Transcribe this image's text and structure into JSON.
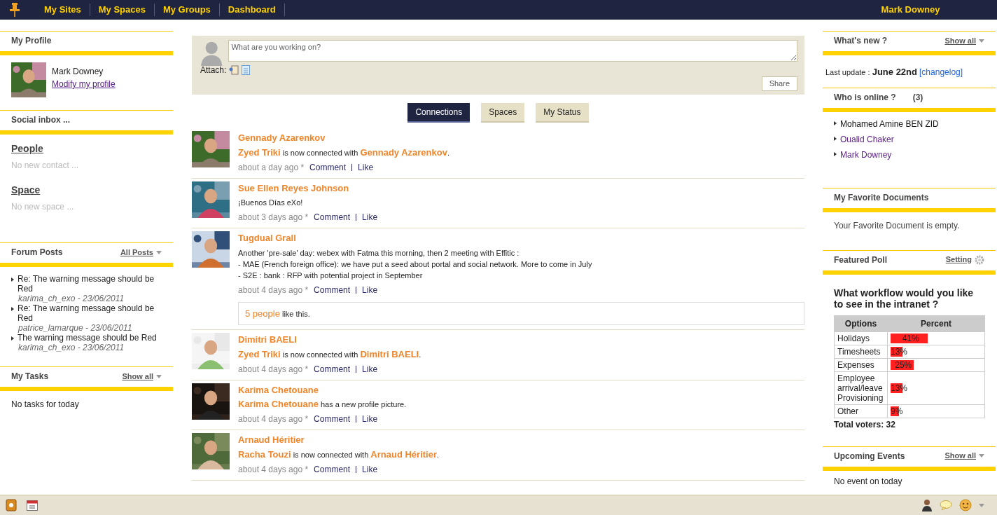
{
  "topbar": {
    "nav": [
      {
        "label": "My Sites"
      },
      {
        "label": "My Spaces"
      },
      {
        "label": "My Groups"
      },
      {
        "label": "Dashboard"
      }
    ],
    "user": "Mark Downey"
  },
  "left": {
    "profile": {
      "title": "My Profile",
      "name": "Mark Downey",
      "link": "Modify my profile"
    },
    "social_inbox": {
      "title": "Social inbox ...",
      "sections": [
        {
          "heading": "People",
          "empty": "No new contact ..."
        },
        {
          "heading": "Space",
          "empty": "No new space ..."
        }
      ]
    },
    "forum": {
      "title": "Forum Posts",
      "action": "All Posts",
      "posts": [
        {
          "title": "Re: The warning message should be Red",
          "meta": "karima_ch_exo - 23/06/2011"
        },
        {
          "title": "Re: The warning message should be Red",
          "meta": "patrice_lamarque - 23/06/2011"
        },
        {
          "title": "The warning message should be Red",
          "meta": "karima_ch_exo - 23/06/2011"
        }
      ]
    },
    "tasks": {
      "title": "My Tasks",
      "action": "Show all",
      "empty": "No tasks for today"
    }
  },
  "composer": {
    "placeholder": "What are you working on?",
    "attach_label": "Attach:",
    "button": "Share"
  },
  "tabs": [
    {
      "label": "Connections",
      "selected": true
    },
    {
      "label": "Spaces",
      "selected": false
    },
    {
      "label": "My Status",
      "selected": false
    }
  ],
  "activities": [
    {
      "name": "Gennady Azarenkov",
      "message": [
        {
          "text": "Zyed Triki",
          "kind": "name"
        },
        {
          "text": " is now connected with ",
          "kind": "text"
        },
        {
          "text": "Gennady Azarenkov",
          "kind": "name"
        },
        {
          "text": ".",
          "kind": "text"
        }
      ],
      "time": "about a day ago *",
      "comment": "Comment",
      "like": "Like"
    },
    {
      "name": "Sue Ellen Reyes Johnson",
      "message": [
        {
          "text": "¡Buenos Días eXo!",
          "kind": "text"
        }
      ],
      "time": "about 3 days ago *",
      "comment": "Comment",
      "like": "Like"
    },
    {
      "name": "Tugdual Grall",
      "message": [
        {
          "text": "Another 'pre-sale' day: webex with Fatma this morning, then 2 meeting with Effitic :\n- MAE (French foreign office): we have put a seed about portal and social network. More to come in July\n- S2E : bank : RFP with potential project in September",
          "kind": "text"
        }
      ],
      "time": "about 4 days ago *",
      "comment": "Comment",
      "like": "Like",
      "likes": {
        "count": "5 people",
        "text": " like this."
      }
    },
    {
      "name": "Dimitri BAELI",
      "message": [
        {
          "text": "Zyed Triki",
          "kind": "name"
        },
        {
          "text": " is now connected with ",
          "kind": "text"
        },
        {
          "text": "Dimitri BAELI",
          "kind": "name"
        },
        {
          "text": ".",
          "kind": "text"
        }
      ],
      "time": "about 4 days ago *",
      "comment": "Comment",
      "like": "Like"
    },
    {
      "name": "Karima Chetouane",
      "message": [
        {
          "text": "Karima Chetouane",
          "kind": "name"
        },
        {
          "text": " has a new profile picture.",
          "kind": "text"
        }
      ],
      "time": "about 4 days ago *",
      "comment": "Comment",
      "like": "Like"
    },
    {
      "name": "Arnaud Héritier",
      "message": [
        {
          "text": "Racha Touzi",
          "kind": "name"
        },
        {
          "text": " is now connected with ",
          "kind": "text"
        },
        {
          "text": "Arnaud Héritier",
          "kind": "name"
        },
        {
          "text": ".",
          "kind": "text"
        }
      ],
      "time": "about 4 days ago *",
      "comment": "Comment",
      "like": "Like"
    }
  ],
  "right": {
    "whats_new": {
      "title": "What's new ?",
      "action": "Show all",
      "label": "Last update :",
      "date": "June 22nd",
      "link": "[changelog]"
    },
    "online": {
      "title": "Who is online ?",
      "count": "(3)",
      "users": [
        {
          "name": "Mohamed Amine BEN ZID",
          "visited": false
        },
        {
          "name": "Oualid Chaker",
          "visited": true
        },
        {
          "name": "Mark Downey",
          "visited": true
        }
      ]
    },
    "favorites": {
      "title": "My Favorite Documents",
      "empty": "Your Favorite Document is empty."
    },
    "poll": {
      "title": "Featured Poll",
      "action": "Setting",
      "question": "What workflow would you like to see in the intranet ?",
      "columns": [
        "Options",
        "Percent"
      ],
      "rows": [
        {
          "option": "Holidays",
          "percent": "41%",
          "level": 0.41
        },
        {
          "option": "Timesheets",
          "percent": "13%",
          "level": 0.13
        },
        {
          "option": "Expenses",
          "percent": "25%",
          "level": 0.25
        },
        {
          "option": "Employee arrival/leave Provisioning",
          "percent": "13%",
          "level": 0.13
        },
        {
          "option": "Other",
          "percent": "9%",
          "level": 0.09
        }
      ],
      "total": "Total voters: 32"
    },
    "events": {
      "title": "Upcoming Events",
      "action": "Show all",
      "empty": "No event on today"
    }
  }
}
